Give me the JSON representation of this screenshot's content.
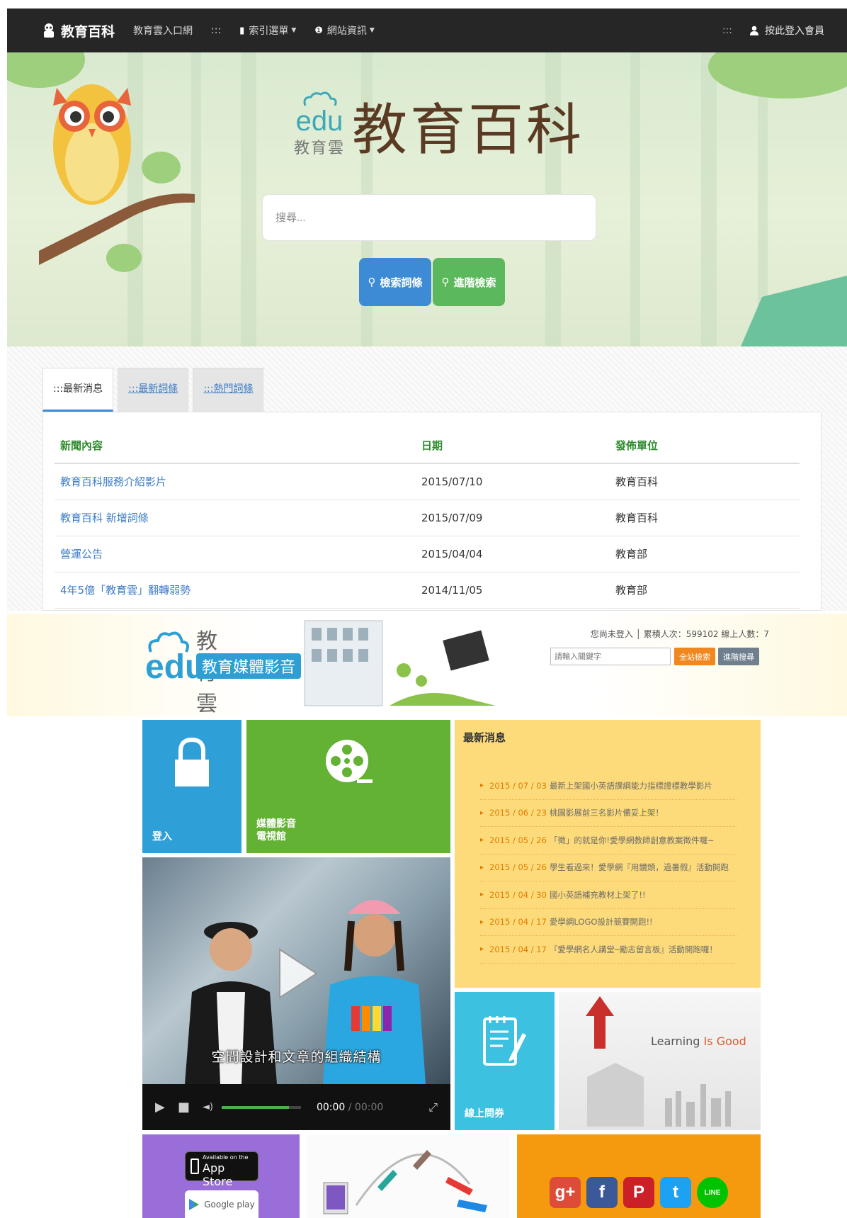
{
  "wiki": {
    "navbar": {
      "brand": "教育百科",
      "portal_link": "教育雲入口網",
      "sep1": ":::",
      "index_menu": "索引選單",
      "info_menu": "網站資訊",
      "sep2": ":::",
      "login_link": "按此登入會員"
    },
    "hero": {
      "logo_edu": "edu",
      "logo_sub": "教育雲",
      "title": "教育百科",
      "search_placeholder": "搜尋...",
      "search_button": "檢索詞條",
      "advanced_button": "進階檢索"
    },
    "tabs": [
      {
        "label": ":::最新消息",
        "active": true
      },
      {
        "label": ":::最新詞條",
        "active": false
      },
      {
        "label": ":::熱門詞條",
        "active": false
      }
    ],
    "news_table": {
      "headers": [
        "新聞內容",
        "日期",
        "發佈單位"
      ],
      "rows": [
        {
          "title": "教育百科服務介紹影片",
          "date": "2015/07/10",
          "unit": "教育百科"
        },
        {
          "title": "教育百科 新增詞條",
          "date": "2015/07/09",
          "unit": "教育百科"
        },
        {
          "title": "營運公告",
          "date": "2015/04/04",
          "unit": "教育部"
        },
        {
          "title": "4年5億「教育雲」翻轉弱勢",
          "date": "2014/11/05",
          "unit": "教育部"
        }
      ]
    }
  },
  "media": {
    "logo": {
      "edu": "edu",
      "name": "教育雲",
      "subtitle": "教育媒體影音"
    },
    "status": "您尚未登入 │ 累積人次：599102 線上人數：7",
    "search_placeholder": "請輸入關鍵字",
    "search_button": "全站檢索",
    "advanced_button": "進階搜尋",
    "tiles": {
      "login": "登入",
      "media": "媒體影音\n電視館",
      "survey": "線上問券",
      "learning_text_a": "Learning ",
      "learning_text_b": "Is Good"
    },
    "news": {
      "title": "最新消息",
      "items": [
        {
          "date": "2015 / 07 / 03",
          "text": "最新上架國小英語課綱能力指標證標教學影片"
        },
        {
          "date": "2015 / 06 / 23",
          "text": "桃園影展前三名影片備妥上架！"
        },
        {
          "date": "2015 / 05 / 26",
          "text": "「徵」的就是你!愛學網教師創意教案徵件囉~"
        },
        {
          "date": "2015 / 05 / 26",
          "text": "學生看過來！愛學網『用鏡頭，過暑假』活動開跑"
        },
        {
          "date": "2015 / 04 / 30",
          "text": "國小英語補充教材上架了!!"
        },
        {
          "date": "2015 / 04 / 17",
          "text": "愛學網LOGO設計競賽開跑!!"
        },
        {
          "date": "2015 / 04 / 17",
          "text": "『愛學網名人講堂─勵志留言板』活動開跑囉！"
        }
      ]
    },
    "video": {
      "subtitle": "空間設計和文章的組織結構",
      "time_current": "00:00",
      "time_total": "00:00",
      "volume_level": 0.85
    },
    "app": {
      "app_store_small": "Available on the",
      "app_store_large": "App Store",
      "google_play": "Google play"
    },
    "social": [
      {
        "name": "google-plus-icon",
        "glyph": "g+",
        "color": "#dd4b39"
      },
      {
        "name": "facebook-icon",
        "glyph": "f",
        "color": "#3b5998"
      },
      {
        "name": "pinterest-icon",
        "glyph": "P",
        "color": "#cb2027"
      },
      {
        "name": "twitter-icon",
        "glyph": "t",
        "color": "#1da1f2"
      },
      {
        "name": "line-icon",
        "glyph": "LINE",
        "color": "#00c300"
      }
    ]
  }
}
